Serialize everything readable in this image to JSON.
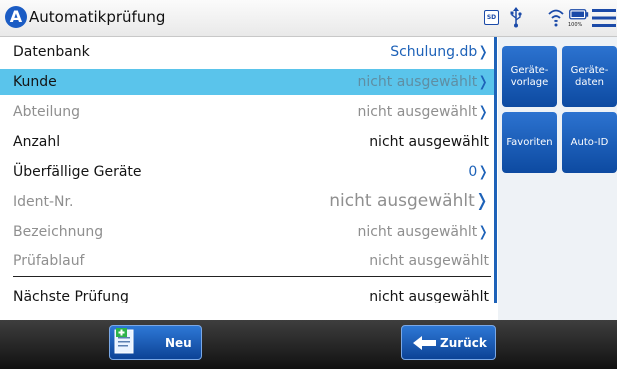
{
  "app": {
    "logo_letter": "A",
    "title": "Automatikprüfung",
    "sd_label": "SD",
    "battery_label": "100%"
  },
  "rows": [
    {
      "label": "Datenbank",
      "value": "Schulung.db",
      "chevron": "❭",
      "label_color": "dark",
      "value_color": "blue"
    },
    {
      "label": "Kunde",
      "value": "nicht ausgewählt",
      "chevron": "❭",
      "label_color": "dark",
      "value_color": "grey",
      "selected": true
    },
    {
      "label": "Abteilung",
      "value": "nicht ausgewählt",
      "chevron": "❭",
      "label_color": "grey",
      "value_color": "grey"
    },
    {
      "label": "Anzahl",
      "value": "nicht ausgewählt",
      "chevron": "",
      "label_color": "dark",
      "value_color": "dark"
    },
    {
      "label": "Überfällige Geräte",
      "value": "0",
      "chevron": "❭",
      "label_color": "dark",
      "value_color": "blue"
    },
    {
      "label": "Ident-Nr.",
      "value": "nicht ausgewählt",
      "chevron": "❭",
      "label_color": "grey",
      "value_color": "grey",
      "big": true
    },
    {
      "label": "Bezeichnung",
      "value": "nicht ausgewählt",
      "chevron": "❭",
      "label_color": "grey",
      "value_color": "grey"
    },
    {
      "label": "Prüfablauf",
      "value": "nicht ausgewählt",
      "chevron": "",
      "label_color": "grey",
      "value_color": "grey"
    },
    {
      "label": "Nächste Prüfung",
      "value": "nicht ausgewählt",
      "chevron": "",
      "label_color": "dark",
      "value_color": "dark"
    }
  ],
  "side_tiles": [
    {
      "label": "Geräte-\nvorlage"
    },
    {
      "label": "Geräte-\ndaten"
    },
    {
      "label": "Favoriten"
    },
    {
      "label": "Auto-ID"
    }
  ],
  "bottom": {
    "new_label": "Neu",
    "back_label": "Zurück"
  },
  "colors": {
    "accent_blue": "#1e62b8",
    "selection": "#5ac4eb"
  }
}
